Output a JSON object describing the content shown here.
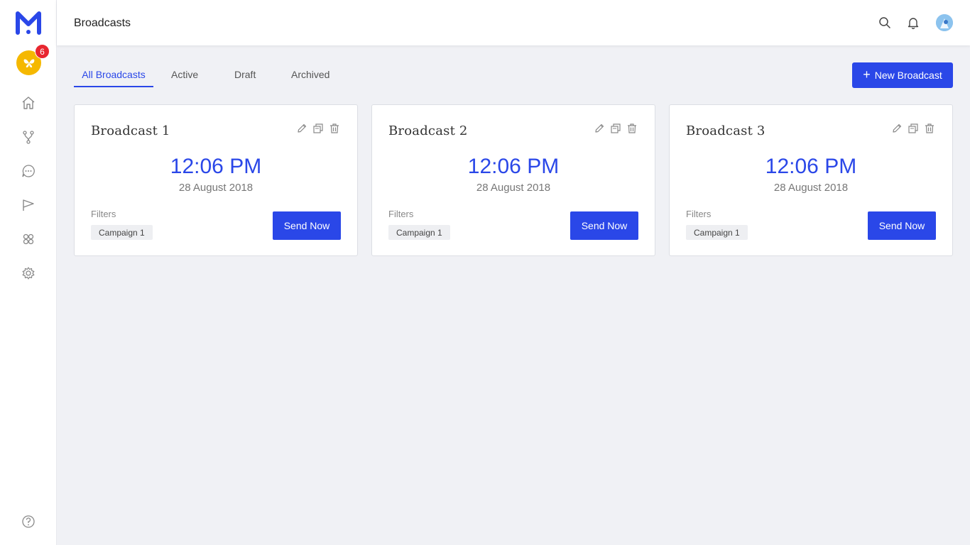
{
  "header": {
    "title": "Broadcasts"
  },
  "sidebar": {
    "badge_count": "6",
    "nav": [
      {
        "icon": "home-icon"
      },
      {
        "icon": "flow-icon"
      },
      {
        "icon": "chat-icon"
      },
      {
        "icon": "broadcast-icon"
      },
      {
        "icon": "integrations-icon"
      },
      {
        "icon": "gear-icon"
      }
    ],
    "help_icon": "help-icon"
  },
  "tabs": [
    {
      "label": "All Broadcasts",
      "active": true
    },
    {
      "label": "Active"
    },
    {
      "label": "Draft"
    },
    {
      "label": "Archived"
    }
  ],
  "new_button": {
    "label": "New Broadcast"
  },
  "cards": [
    {
      "title": "Broadcast 1",
      "time": "12:06 PM",
      "date": "28 August 2018",
      "filters_label": "Filters",
      "filter_chip": "Campaign 1",
      "send_label": "Send Now"
    },
    {
      "title": "Broadcast 2",
      "time": "12:06 PM",
      "date": "28 August 2018",
      "filters_label": "Filters",
      "filter_chip": "Campaign 1",
      "send_label": "Send Now"
    },
    {
      "title": "Broadcast 3",
      "time": "12:06 PM",
      "date": "28 August 2018",
      "filters_label": "Filters",
      "filter_chip": "Campaign 1",
      "send_label": "Send Now"
    }
  ],
  "colors": {
    "accent": "#2a47e8",
    "badge": "#e8262f",
    "bot_avatar": "#f5b800"
  }
}
